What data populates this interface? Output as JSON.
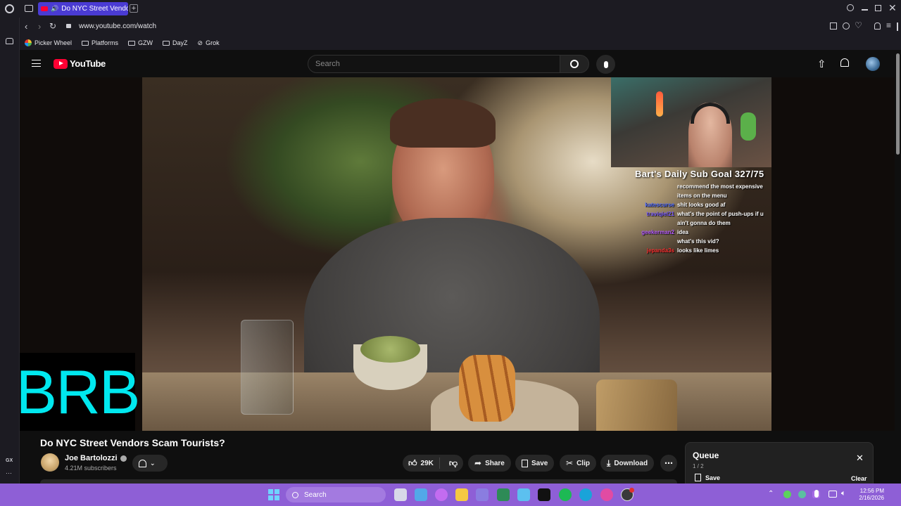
{
  "browser": {
    "tab": {
      "title": "Do NYC Street Vendors"
    },
    "address": "www.youtube.com/watch",
    "bookmarks": [
      "Picker Wheel",
      "Platforms",
      "GZW",
      "DayZ",
      "Grok"
    ],
    "sidebar_label": "GX"
  },
  "youtube": {
    "logo_text": "YouTube",
    "search_placeholder": "Search"
  },
  "video": {
    "sub_goal": "Bart's Daily Sub Goal 327/75",
    "brb": "BRB",
    "chat": [
      {
        "name": "",
        "text": "recommend the most expensive",
        "color": "#ffffff"
      },
      {
        "name": "",
        "text": "items on the menu",
        "color": "#ffffff"
      },
      {
        "name": "katescurse",
        "text": "shit looks good af",
        "color": "#4f6bff"
      },
      {
        "name": "traviqiel21",
        "text": "what's the point of push-ups if u",
        "color": "#7a5cff"
      },
      {
        "name": "",
        "text": "ain't gonna do them",
        "color": "#ffffff"
      },
      {
        "name": "geekerman2",
        "text": "idea",
        "color": "#b65cff"
      },
      {
        "name": "",
        "text": "what's this vid?",
        "color": "#2e4cff"
      },
      {
        "name": "jepanda3s",
        "text": "looks like limes",
        "color": "#ff3030"
      }
    ]
  },
  "meta": {
    "title": "Do NYC Street Vendors Scam Tourists?",
    "channel": "Joe Bartolozzi",
    "subscribers": "4.21M subscribers",
    "likes": "29K",
    "actions": {
      "share": "Share",
      "save": "Save",
      "clip": "Clip",
      "download": "Download"
    }
  },
  "queue": {
    "title": "Queue",
    "position": "1 / 2",
    "save": "Save",
    "clear": "Clear"
  },
  "taskbar": {
    "search": "Search",
    "time": "12:56 PM",
    "date": "2/16/2026"
  }
}
